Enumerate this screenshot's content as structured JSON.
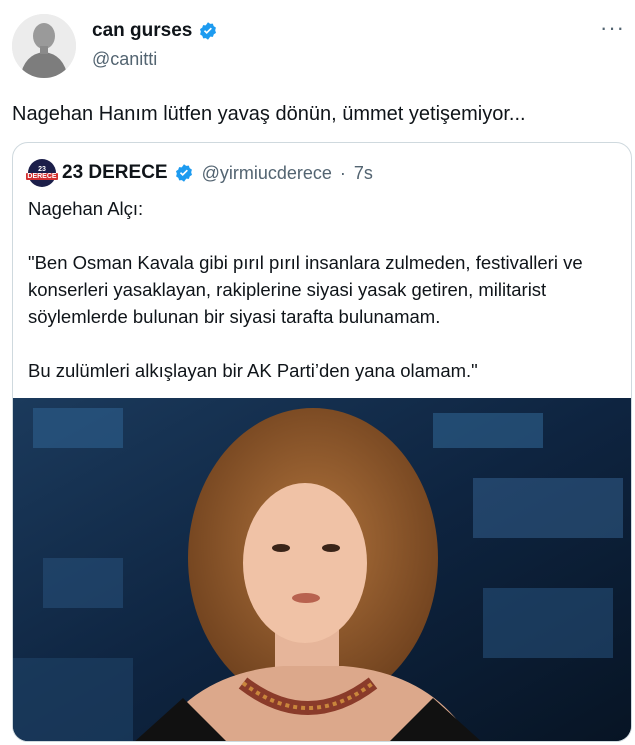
{
  "author": {
    "name": "can gurses",
    "handle": "@canitti",
    "verified": true
  },
  "more_icon": "more-horizontal-icon",
  "tweet": {
    "text": "Nagehan Hanım lütfen yavaş dönün, ümmet yetişemiyor..."
  },
  "quoted": {
    "avatar_text_top": "23",
    "avatar_text_bottom": "DERECE",
    "name": "23 DERECE",
    "handle": "@yirmiucderece",
    "separator": "·",
    "time": "7s",
    "verified": true,
    "body": "Nagehan Alçı:\n\n\"Ben Osman Kavala gibi pırıl pırıl insanlara zulmeden, festivalleri ve konserleri yasaklayan, rakiplerine siyasi yasak getiren, militarist söylemlerde bulunan bir siyasi tarafta bulunamam.\n\nBu zulümleri alkışlayan bir AK Parti’den yana olamam.\""
  },
  "colors": {
    "verified_blue": "#1d9bf0",
    "text": "#0f1419",
    "secondary": "#536471",
    "border": "#cfd9de"
  }
}
